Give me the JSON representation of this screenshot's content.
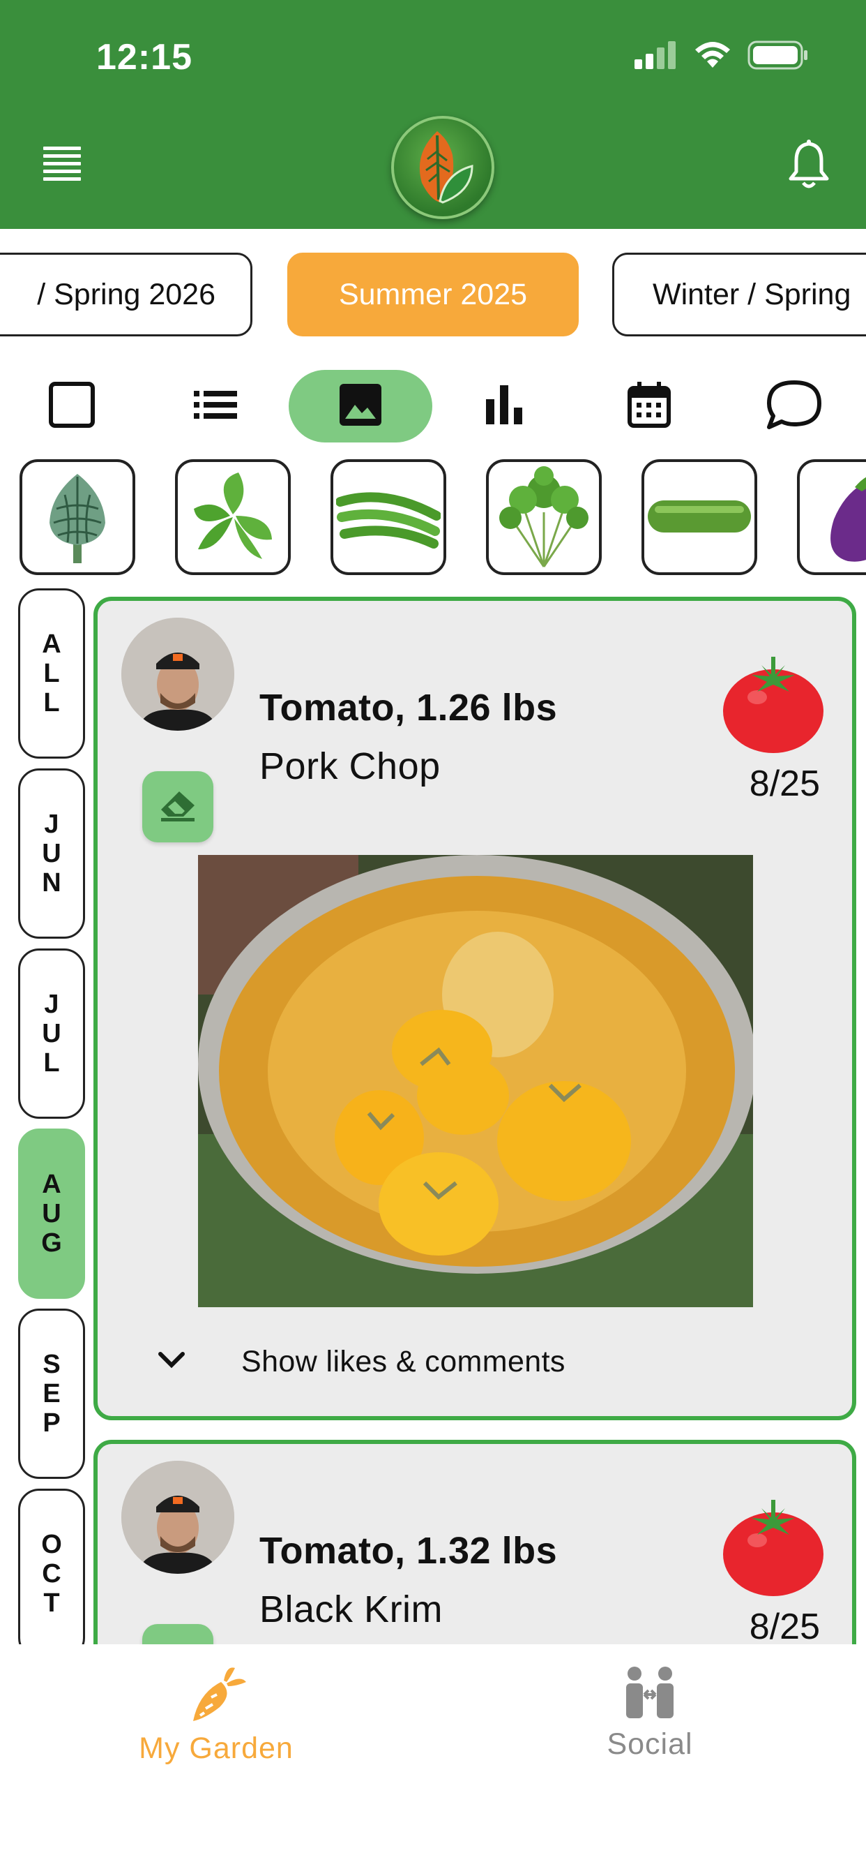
{
  "status_bar": {
    "time": "12:15"
  },
  "seasons": [
    "/ Spring 2026",
    "Summer 2025",
    "Winter / Spring"
  ],
  "active_season": "Summer 2025",
  "view_modes": [
    "grid",
    "list",
    "photos",
    "stats",
    "calendar",
    "chat"
  ],
  "active_view": "photos",
  "vegetables": [
    "artichoke",
    "basil",
    "green-beans",
    "cilantro",
    "cucumber",
    "eggplant"
  ],
  "months": [
    {
      "id": "all",
      "letters": [
        "A",
        "L",
        "L"
      ]
    },
    {
      "id": "jun",
      "letters": [
        "J",
        "U",
        "N"
      ]
    },
    {
      "id": "jul",
      "letters": [
        "J",
        "U",
        "L"
      ]
    },
    {
      "id": "aug",
      "letters": [
        "A",
        "U",
        "G"
      ]
    },
    {
      "id": "sep",
      "letters": [
        "S",
        "E",
        "P"
      ]
    },
    {
      "id": "oct",
      "letters": [
        "O",
        "C",
        "T"
      ]
    }
  ],
  "active_month": "aug",
  "posts": [
    {
      "title": "Tomato, 1.26 lbs",
      "variety": "Pork Chop",
      "date": "8/25",
      "toggle_label": "Show likes & comments"
    },
    {
      "title": "Tomato, 1.32 lbs",
      "variety": "Black Krim",
      "date": "8/25"
    }
  ],
  "tabs": {
    "my_garden": "My Garden",
    "social": "Social"
  },
  "colors": {
    "header_green": "#3a8f3c",
    "active_orange": "#f7a93b",
    "active_green": "#7fca82",
    "card_border": "#3eaa45",
    "inactive_tab": "#8a8a8a"
  }
}
